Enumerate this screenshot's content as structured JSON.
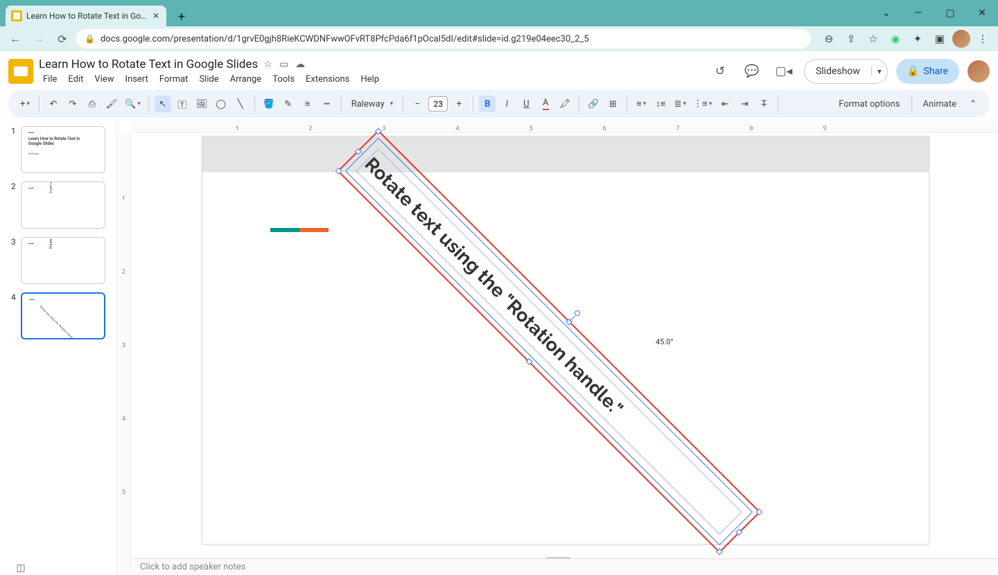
{
  "browser": {
    "tab_title": "Learn How to Rotate Text in Goog",
    "url": "docs.google.com/presentation/d/1grvE0gjh8RieKCWDNFwwOFvRT8PfcPda6f1pOcal5dI/edit#slide=id.g219e04eec30_2_5"
  },
  "doc": {
    "title": "Learn How to Rotate Text in Google Slides",
    "menu": [
      "File",
      "Edit",
      "View",
      "Insert",
      "Format",
      "Slide",
      "Arrange",
      "Tools",
      "Extensions",
      "Help"
    ]
  },
  "header": {
    "slideshow": "Slideshow",
    "share": "Share"
  },
  "toolbar": {
    "font": "Raleway",
    "font_size": "23",
    "format_options": "Format options",
    "animate": "Animate"
  },
  "thumbs": {
    "1": {
      "title": "Learn How to Rotate Text in Google Slides",
      "sub": "Slidesgo"
    },
    "2": {
      "title": "Insert slide. You can put your content."
    },
    "3": {
      "title": "Rotate text via the \"Arrange\" menu tab."
    },
    "4": {
      "title": "Rotate text using the \"Rotation handle.\""
    }
  },
  "canvas": {
    "text": "Rotate text using the \"Rotation handle.\"",
    "angle": "45.0°"
  },
  "ruler_h": [
    "1",
    "2",
    "3",
    "4",
    "5",
    "6",
    "7",
    "8",
    "9"
  ],
  "ruler_v": [
    "1",
    "2",
    "3",
    "4",
    "5"
  ],
  "notes": {
    "placeholder": "Click to add speaker notes"
  }
}
